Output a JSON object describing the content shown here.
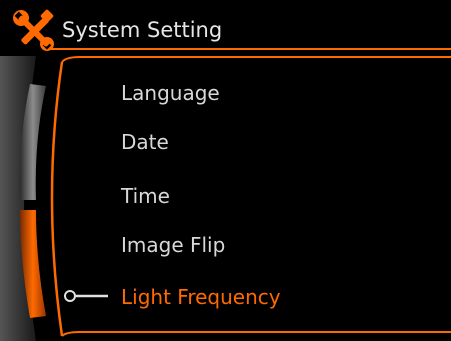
{
  "header": {
    "title": "System Setting",
    "icon": "wrench-screwdriver-icon"
  },
  "menu": {
    "items": [
      {
        "label": "Language",
        "selected": false
      },
      {
        "label": "Date",
        "selected": false
      },
      {
        "label": "Time",
        "selected": false
      },
      {
        "label": "Image Flip",
        "selected": false
      },
      {
        "label": "Light Frequency",
        "selected": true
      }
    ]
  },
  "colors": {
    "background": "#000000",
    "accent": "#ff6a00",
    "text": "#d8d8d8",
    "title_text": "#e6e6e6",
    "wheel_gray": "#8a8a8a"
  }
}
